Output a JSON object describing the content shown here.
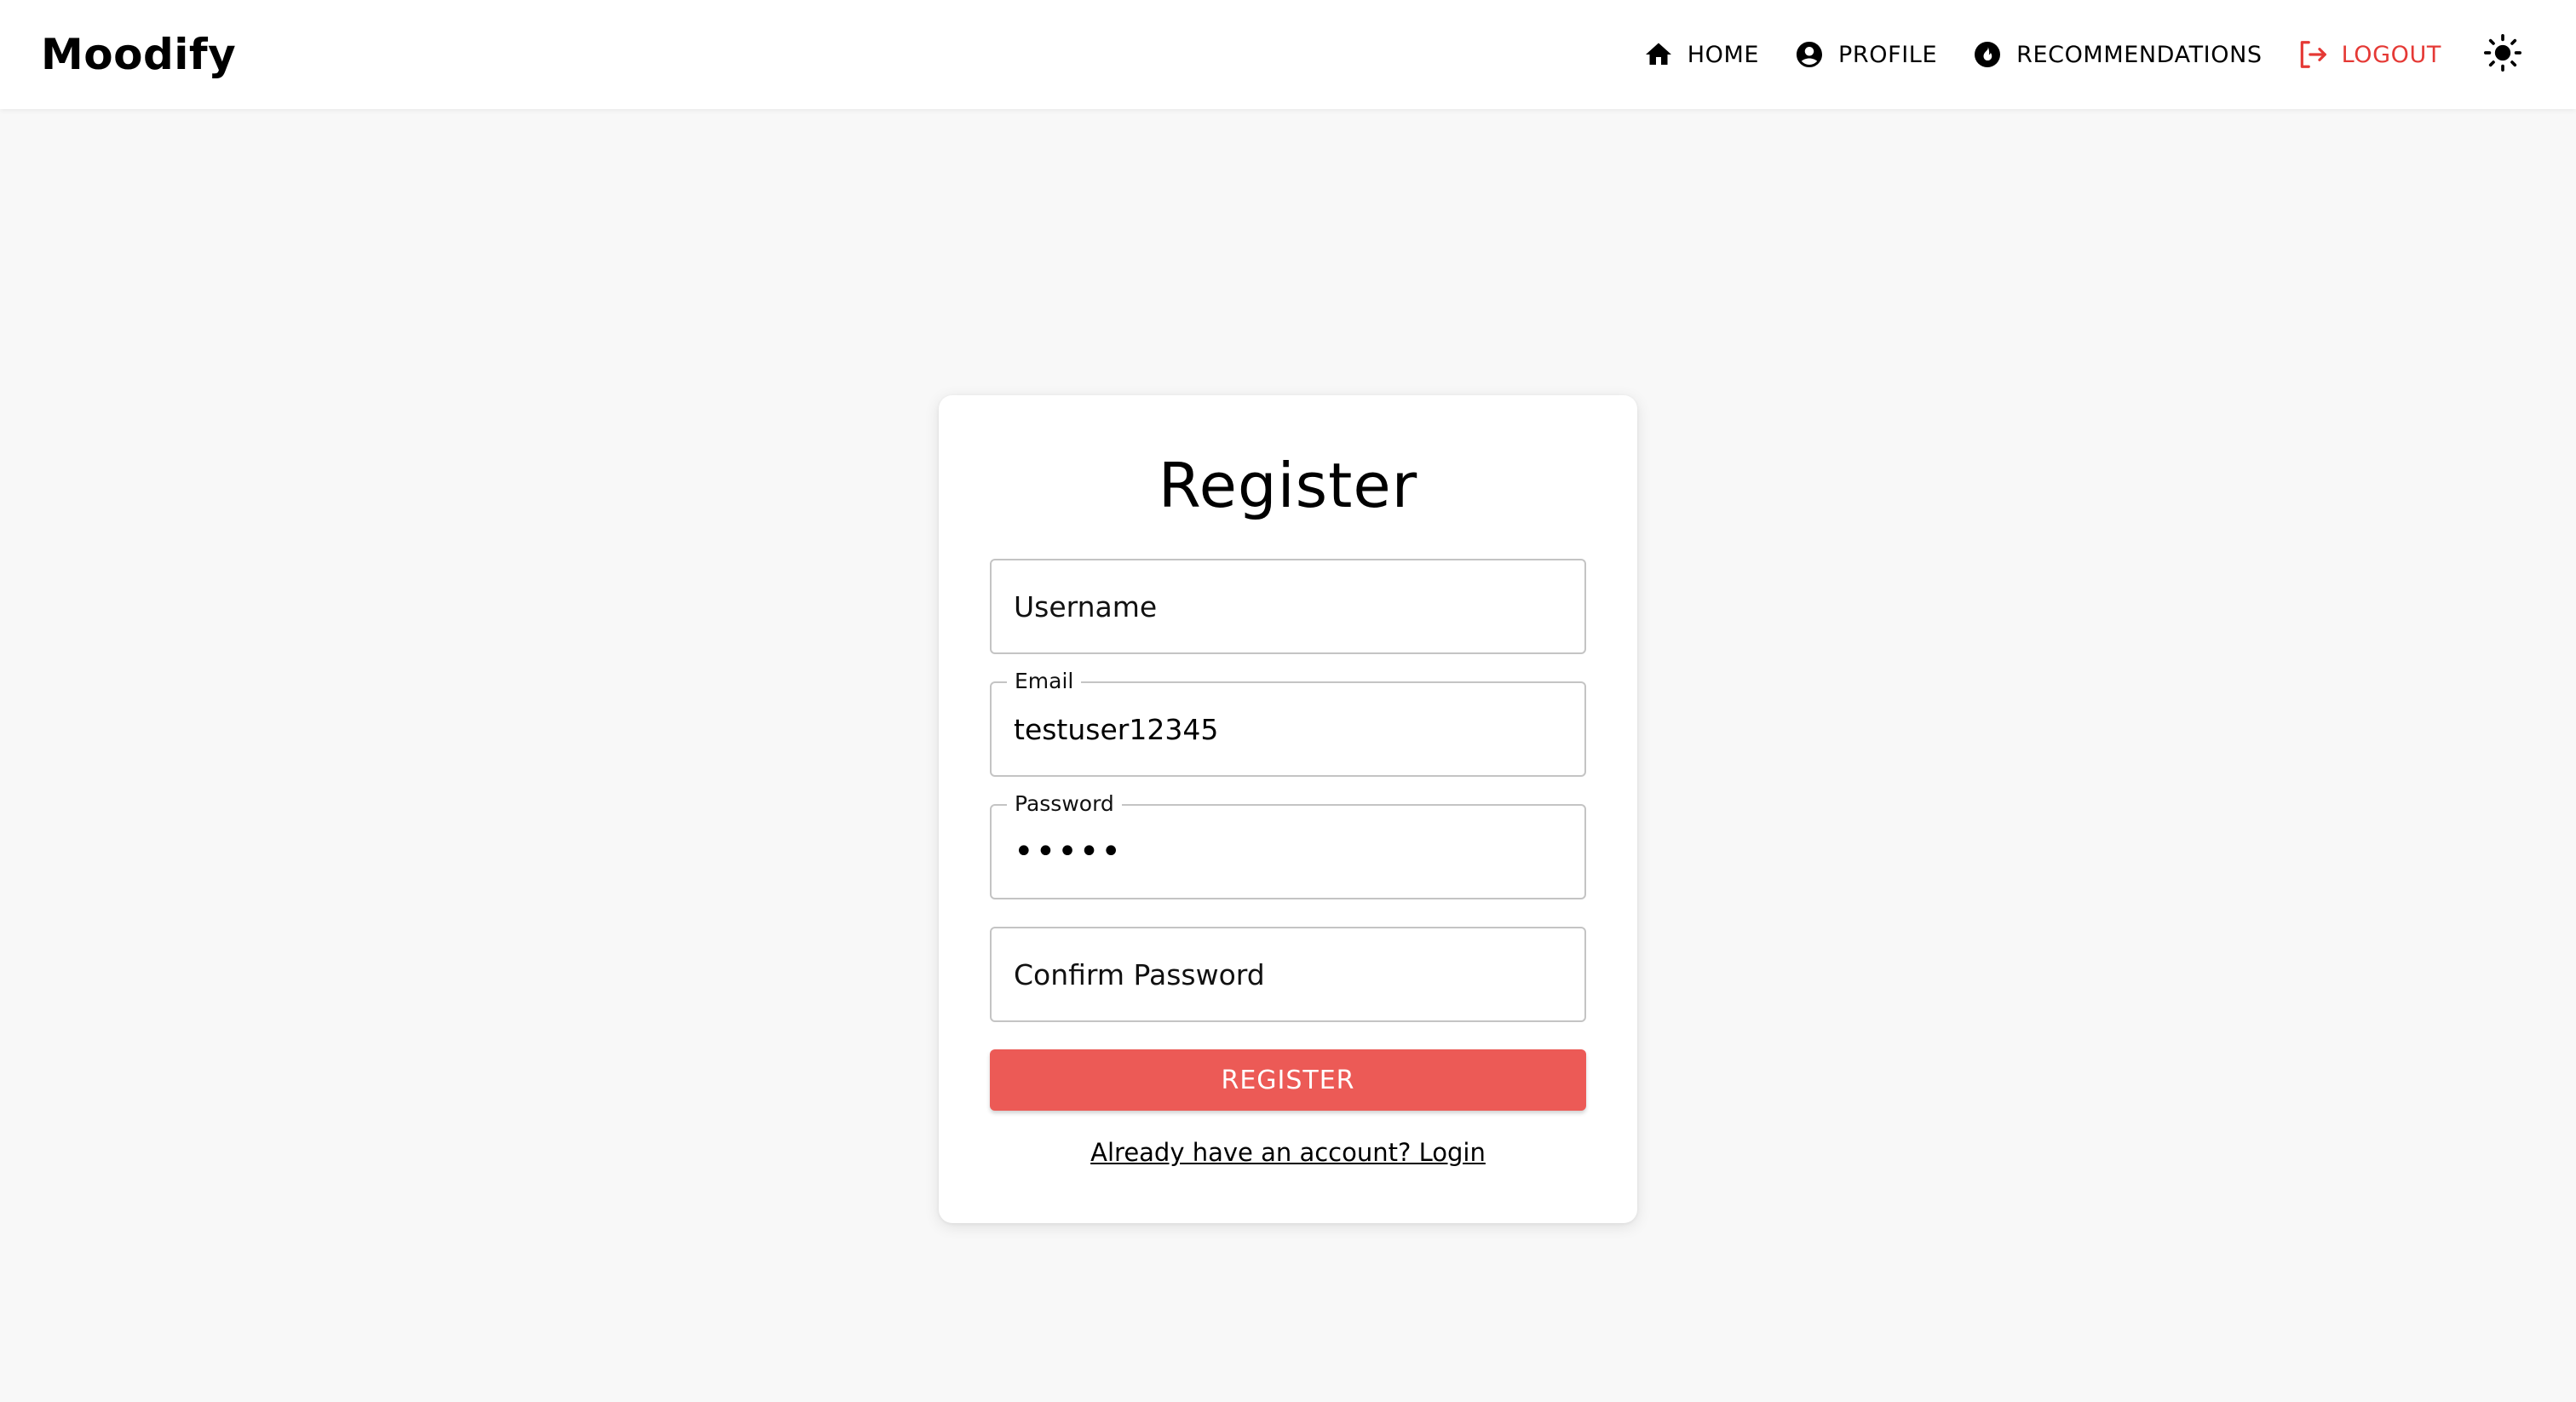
{
  "header": {
    "brand": "Moodify",
    "nav": [
      {
        "label": "HOME",
        "icon": "home-icon"
      },
      {
        "label": "PROFILE",
        "icon": "account-circle-icon"
      },
      {
        "label": "RECOMMENDATIONS",
        "icon": "whatshot-icon"
      },
      {
        "label": "LOGOUT",
        "icon": "logout-icon",
        "color": "#e53935"
      }
    ],
    "theme_toggle_icon": "sun-icon"
  },
  "register": {
    "title": "Register",
    "username": {
      "placeholder": "Username",
      "value": ""
    },
    "email": {
      "label": "Email",
      "value": "testuser12345"
    },
    "password": {
      "label": "Password",
      "value": "•••••"
    },
    "confirm_password": {
      "placeholder": "Confirm Password",
      "value": ""
    },
    "submit_label": "REGISTER",
    "login_link": "Already have an account? Login"
  },
  "colors": {
    "accent": "#ec5a56",
    "logout": "#e53935",
    "background": "#f8f8f8"
  }
}
